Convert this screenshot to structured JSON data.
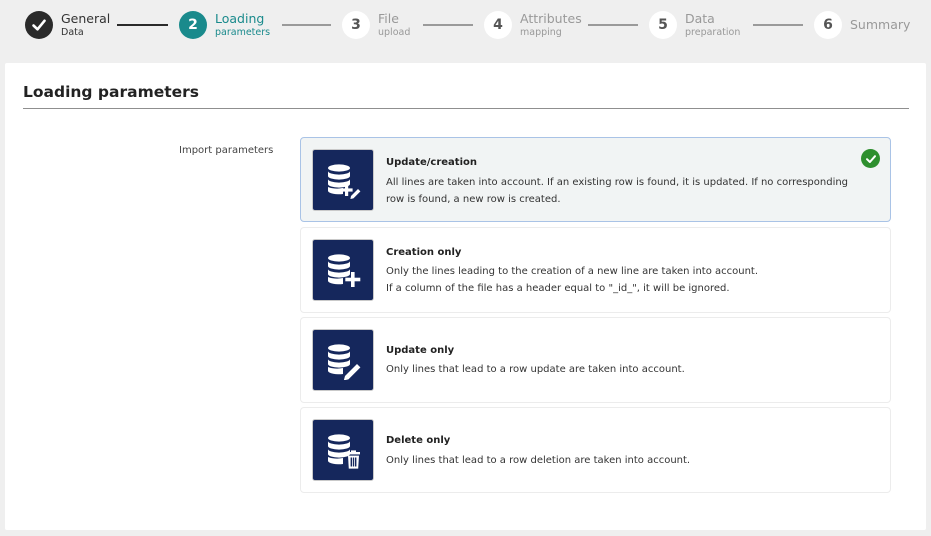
{
  "stepper": {
    "steps": [
      {
        "number": "",
        "title": "General",
        "subtitle": "Data",
        "state": "done"
      },
      {
        "number": "2",
        "title": "Loading",
        "subtitle": "parameters",
        "state": "active"
      },
      {
        "number": "3",
        "title": "File",
        "subtitle": "upload",
        "state": "todo"
      },
      {
        "number": "4",
        "title": "Attributes",
        "subtitle": "mapping",
        "state": "todo"
      },
      {
        "number": "5",
        "title": "Data",
        "subtitle": "preparation",
        "state": "todo"
      },
      {
        "number": "6",
        "title": "Summary",
        "subtitle": "",
        "state": "todo"
      }
    ]
  },
  "panel": {
    "title": "Loading parameters",
    "field_label": "Import parameters",
    "options": [
      {
        "title": "Update/creation",
        "description": "All lines are taken into account. If an existing row is found, it is updated. If no corresponding row is found, a new row is created.",
        "icon": "database-plus-pencil-icon",
        "selected": true
      },
      {
        "title": "Creation only",
        "description": "Only the lines leading to the creation of a new line are taken into account.",
        "description2": "If a column of the file has a header equal to \"_id_\", it will be ignored.",
        "icon": "database-plus-icon",
        "selected": false
      },
      {
        "title": "Update only",
        "description": "Only lines that lead to a row update are taken into account.",
        "icon": "database-pencil-icon",
        "selected": false
      },
      {
        "title": "Delete only",
        "description": "Only lines that lead to a row deletion are taken into account.",
        "icon": "database-trash-icon",
        "selected": false
      }
    ]
  },
  "colors": {
    "accent": "#1a8a8c",
    "icon_bg": "#15275c",
    "selected_check": "#2e8f2e",
    "selected_border": "#a9c3e6"
  }
}
